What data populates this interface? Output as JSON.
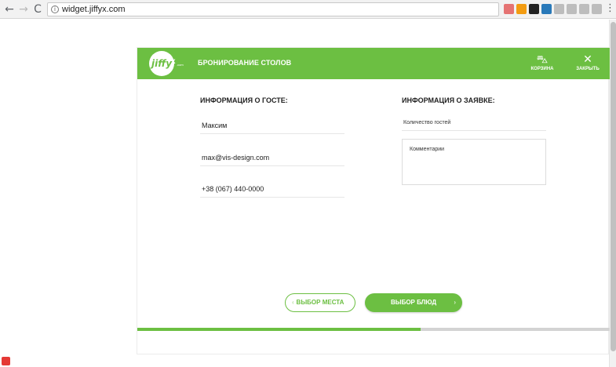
{
  "browser": {
    "url": "widget.jiffyx.com",
    "back_icon": "←",
    "forward_icon": "→",
    "reload_icon": "C",
    "info_icon": "i",
    "menu_icon": "⋮",
    "extensions": [
      {
        "name": "extension-icon-1",
        "color": "#e57373"
      },
      {
        "name": "rss-icon",
        "color": "#f39c12"
      },
      {
        "name": "extension-icon-3",
        "color": "#222222"
      },
      {
        "name": "extension-icon-4",
        "color": "#2979b9"
      },
      {
        "name": "extension-icon-5",
        "color": "#bdbdbd"
      },
      {
        "name": "extension-icon-6",
        "color": "#bdbdbd"
      },
      {
        "name": "extension-icon-7",
        "color": "#bdbdbd"
      },
      {
        "name": "extension-icon-8",
        "color": "#bdbdbd"
      }
    ]
  },
  "widget": {
    "accent_color": "#6cbf42",
    "logo_text": "jiffy",
    "logo_x": "x",
    "logo_com": ".com",
    "title": "БРОНИРОВАНИЕ СТОЛОВ",
    "basket": {
      "icon": "basket-icon",
      "glyph": "⛍",
      "label": "КОРЗИНА"
    },
    "close": {
      "icon": "close-icon",
      "glyph": "✕",
      "label": "ЗАКРЫТЬ"
    }
  },
  "guest": {
    "title": "ИНФОРМАЦИЯ О ГОСТЕ:",
    "name": "Максим",
    "email": "max@vis-design.com",
    "phone": "+38 (067) 440-0000"
  },
  "request": {
    "title": "ИНФОРМАЦИЯ О ЗАЯВКЕ:",
    "guests_placeholder": "Количество гостей",
    "comment_placeholder": "Комментарии"
  },
  "actions": {
    "prev_label": "ВЫБОР МЕСТА",
    "prev_chevron": "‹",
    "next_label": "ВЫБОР БЛЮД",
    "next_chevron": "›"
  },
  "progress": {
    "value": 0.6
  }
}
